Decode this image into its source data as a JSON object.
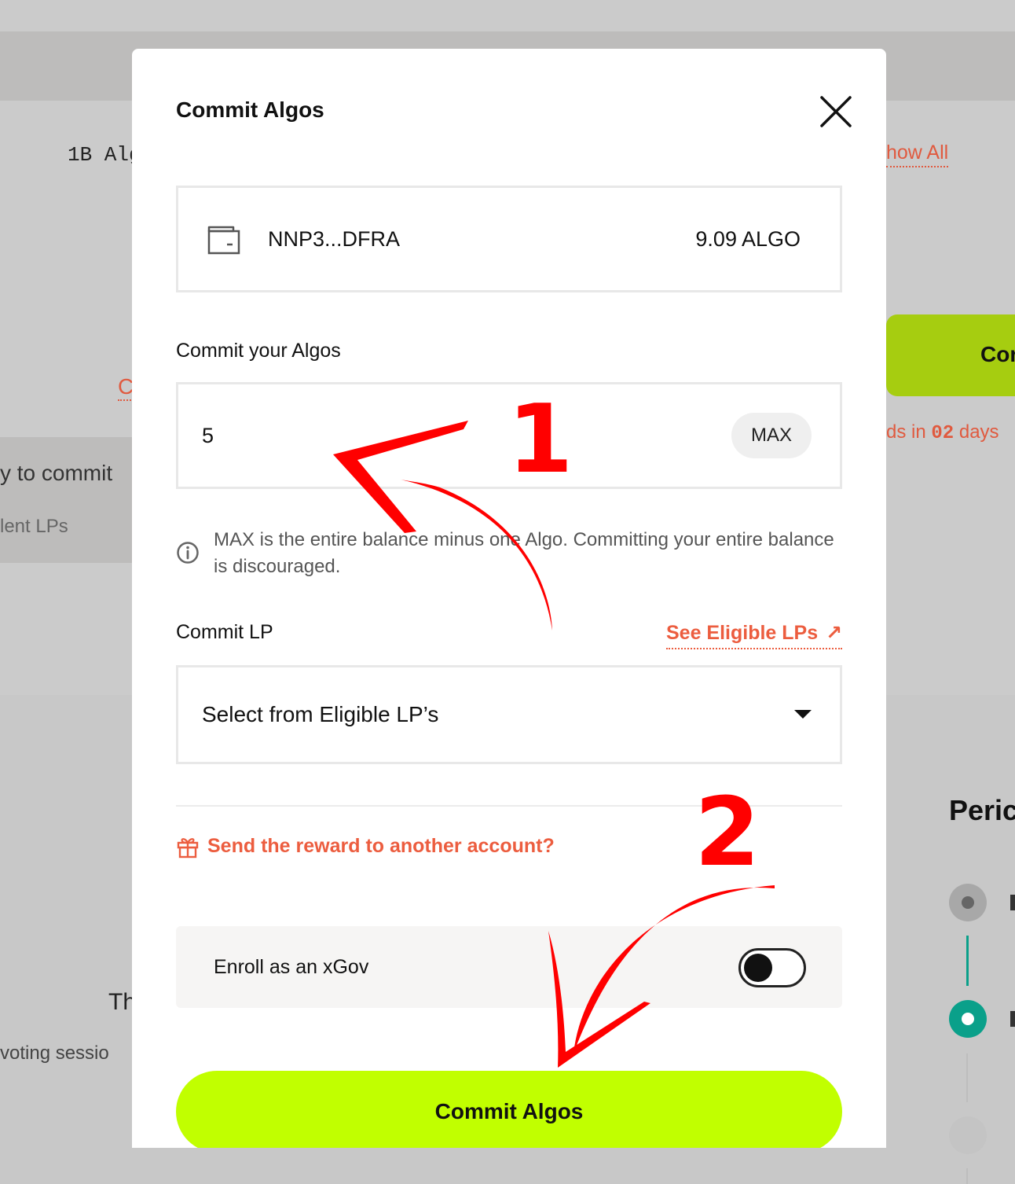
{
  "background": {
    "mono_text": "1B Alg",
    "show_all": "how All",
    "green_button_label": "Cor",
    "c_link": "C",
    "ends_prefix": "ds in ",
    "ends_days": "02",
    "ends_suffix": " days",
    "commit_partial": "y to commit",
    "lps_partial": "lent LPs",
    "th_partial": "Th",
    "voting_partial": "voting sessio",
    "period_partial": "Peric"
  },
  "modal": {
    "title": "Commit Algos",
    "account": {
      "address": "NNP3...DFRA",
      "balance": "9.09 ALGO"
    },
    "commit_label": "Commit your Algos",
    "amount_value": "5",
    "max_label": "MAX",
    "info_text": "MAX is the entire balance minus one Algo. Committing your entire balance is discouraged.",
    "lp_label": "Commit LP",
    "see_lps": "See Eligible LPs",
    "see_lps_arrow": "↗",
    "lp_select_placeholder": "Select from Eligible LP’s",
    "reward_link": "Send the reward to another account?",
    "xgov_label": "Enroll as an xGov",
    "xgov_enabled": false,
    "commit_button": "Commit Algos"
  },
  "annotations": {
    "marker_1": "1",
    "marker_2": "2"
  },
  "colors": {
    "accent": "#c1ff00",
    "link": "#ec5d3f",
    "teal": "#0aa08a",
    "annotation": "#ff0000"
  }
}
